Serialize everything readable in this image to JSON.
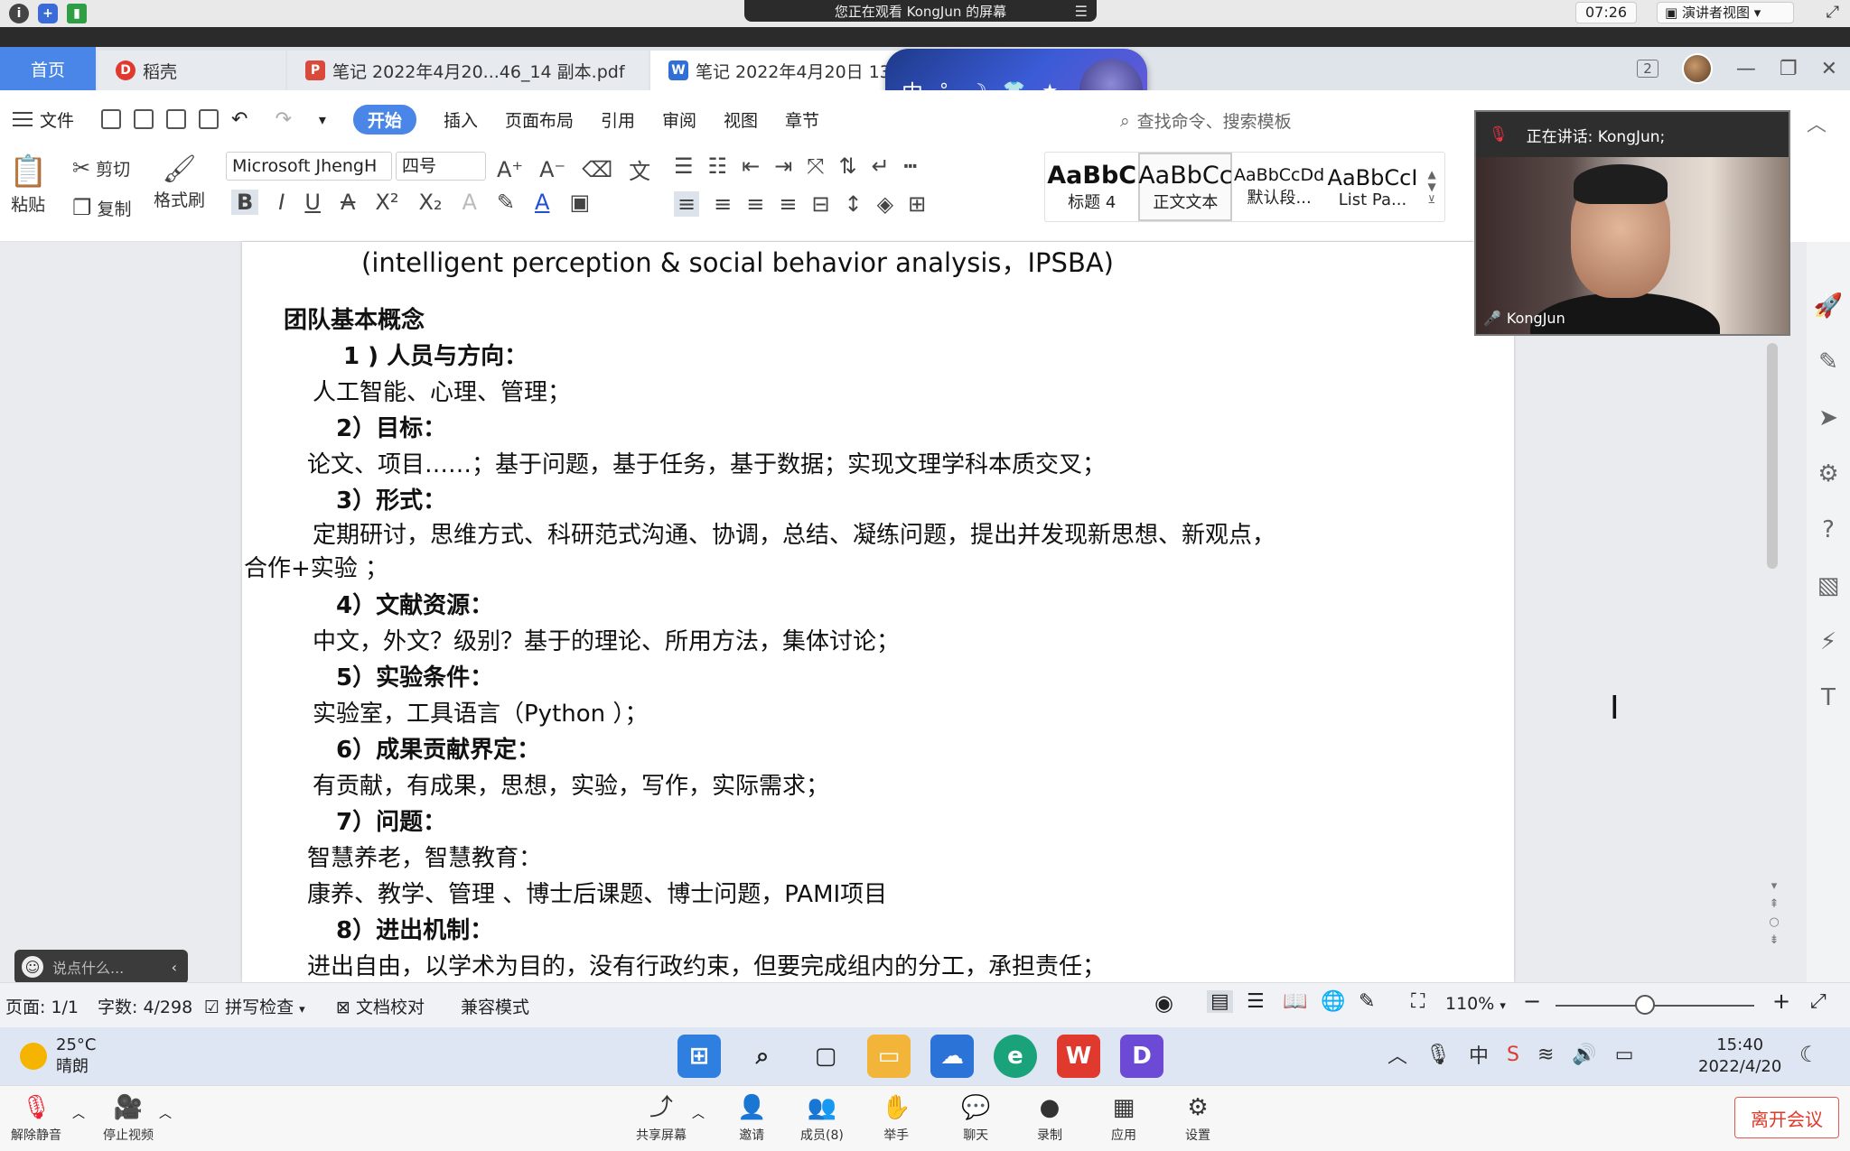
{
  "top_bar": {
    "share_notice": "您正在观看 KongJun 的屏幕",
    "time": "07:26",
    "presenter_view": "演讲者视图"
  },
  "tabs": {
    "home": "首页",
    "daoke": "稻壳",
    "pdf": "笔记 2022年4月20...46_14 副本.pdf",
    "doc": "笔记 2022年4月20日 13"
  },
  "ime": {
    "lang": "中"
  },
  "window_controls": {
    "page_count": "2"
  },
  "menu": {
    "file": "文件",
    "items": [
      "开始",
      "插入",
      "页面布局",
      "引用",
      "审阅",
      "视图",
      "章节"
    ],
    "search_placeholder": "查找命令、搜索模板"
  },
  "ribbon": {
    "paste": "粘贴",
    "cut": "剪切",
    "copy": "复制",
    "format_painter": "格式刷",
    "font_name": "Microsoft JhengH",
    "font_size": "四号",
    "styles": [
      {
        "preview": "AaBbC",
        "label": "标题 4"
      },
      {
        "preview": "AaBbCc",
        "label": "正文文本"
      },
      {
        "preview": "AaBbCcDd",
        "label": "默认段..."
      },
      {
        "preview": "AaBbCcI",
        "label": "List Pa..."
      }
    ]
  },
  "document": {
    "lines": [
      "(intelligent perception & social behavior analysis，IPSBA)",
      "团队基本概念",
      "1 ) 人员与方向：",
      "人工智能、心理、管理；",
      "2）目标：",
      "论文、项目……；基于问题，基于任务，基于数据；实现文理学科本质交叉；",
      "3）形式：",
      "定期研讨，思维方式、科研范式沟通、协调，总结、凝练问题，提出并发现新思想、新观点，",
      "合作+实验 ；",
      "4）文献资源：",
      "中文，外文？级别？基于的理论、所用方法，集体讨论；",
      "5）实验条件：",
      "实验室，工具语言（Python ）；",
      "6）成果贡献界定：",
      "有贡献，有成果，思想，实验，写作，实际需求；",
      "7）问题：",
      "智慧养老，智慧教育：",
      "康养、教学、管理 、博士后课题、博士问题，PAMI项目",
      "8）进出机制：",
      "进出自由，以学术为目的，没有行政约束，但要完成组内的分工，承担责任；"
    ]
  },
  "video": {
    "speaking": "正在讲话: KongJun;",
    "name": "KongJun"
  },
  "comment": {
    "placeholder": "说点什么..."
  },
  "status": {
    "page": "页面: 1/1",
    "words": "字数: 4/298",
    "spell": "拼写检查",
    "proof": "文档校对",
    "compat": "兼容模式",
    "zoom": "110%",
    "zoom_level": 0.45
  },
  "taskbar": {
    "temp": "25°C",
    "weather": "晴朗",
    "time": "15:40",
    "date": "2022/4/20",
    "ime": "中"
  },
  "meeting": {
    "unmute": "解除静音",
    "stop_video": "停止视频",
    "share": "共享屏幕",
    "invite": "邀请",
    "members": "成员(8)",
    "raise_hand": "举手",
    "chat": "聊天",
    "record": "录制",
    "apps": "应用",
    "settings": "设置",
    "leave": "离开会议"
  }
}
